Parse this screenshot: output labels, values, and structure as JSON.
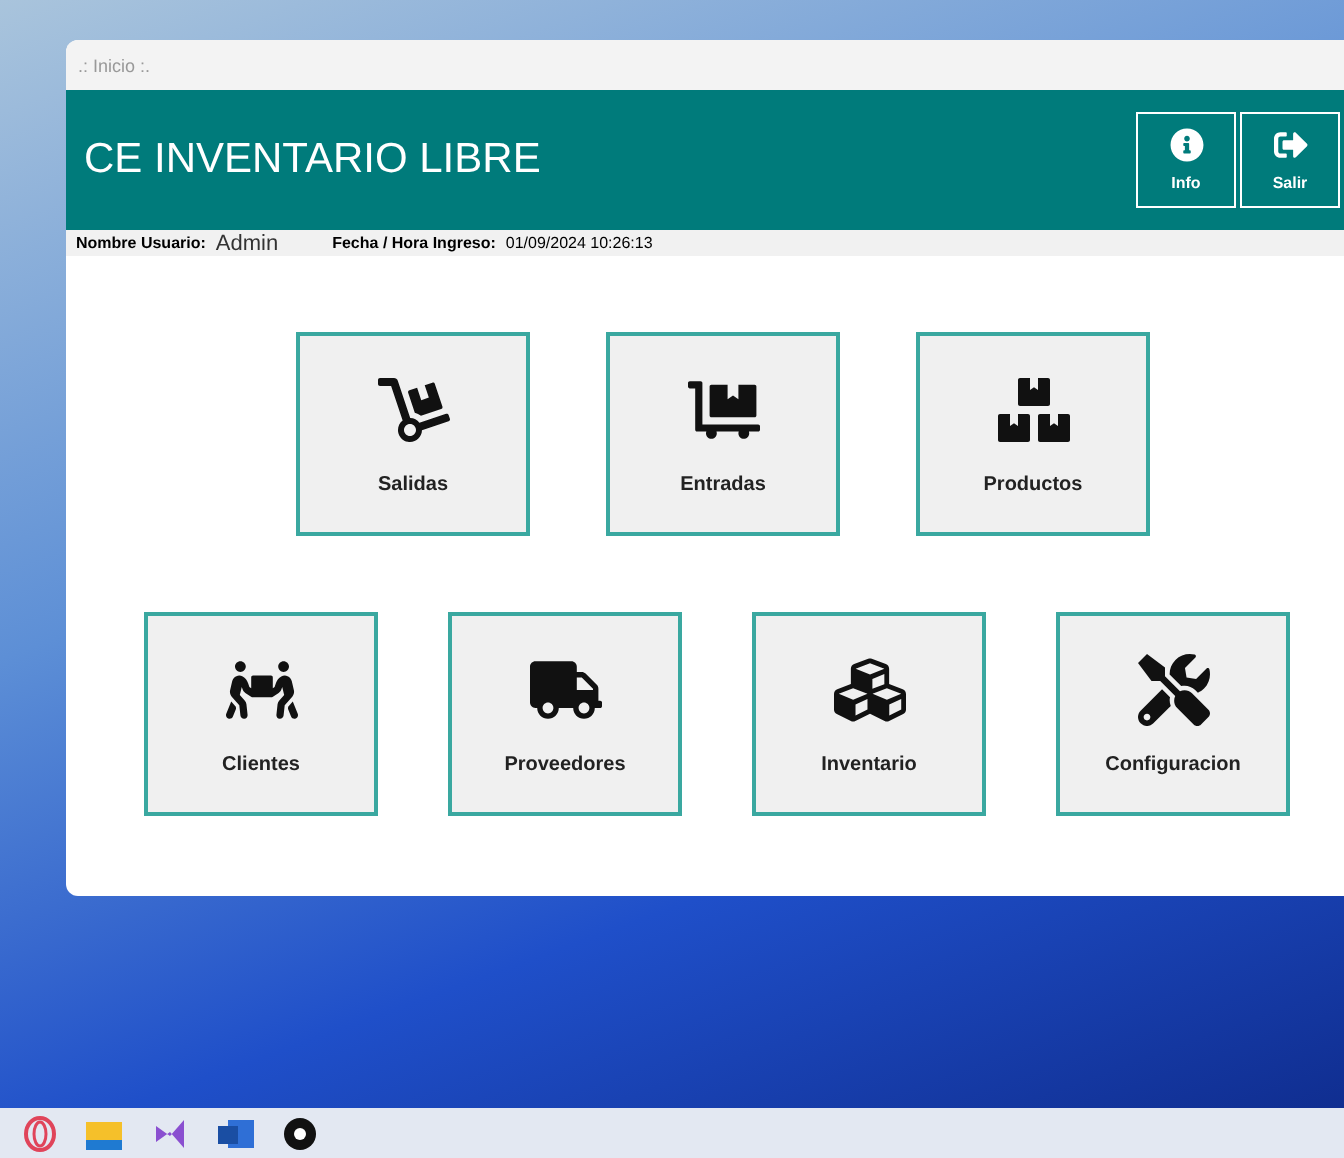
{
  "window": {
    "title": ".: Inicio :."
  },
  "header": {
    "title": "CE INVENTARIO LIBRE",
    "buttons": [
      {
        "label": "Info"
      },
      {
        "label": "Salir"
      }
    ]
  },
  "session": {
    "user_label": "Nombre Usuario:",
    "user": "Admin",
    "date_label": "Fecha / Hora Ingreso:",
    "date": "01/09/2024 10:26:13"
  },
  "tile_rows": [
    [
      {
        "label": "Salidas"
      },
      {
        "label": "Entradas"
      },
      {
        "label": "Productos"
      }
    ],
    [
      {
        "label": "Clientes"
      },
      {
        "label": "Proveedores"
      },
      {
        "label": "Inventario"
      },
      {
        "label": "Configuracion"
      }
    ]
  ]
}
